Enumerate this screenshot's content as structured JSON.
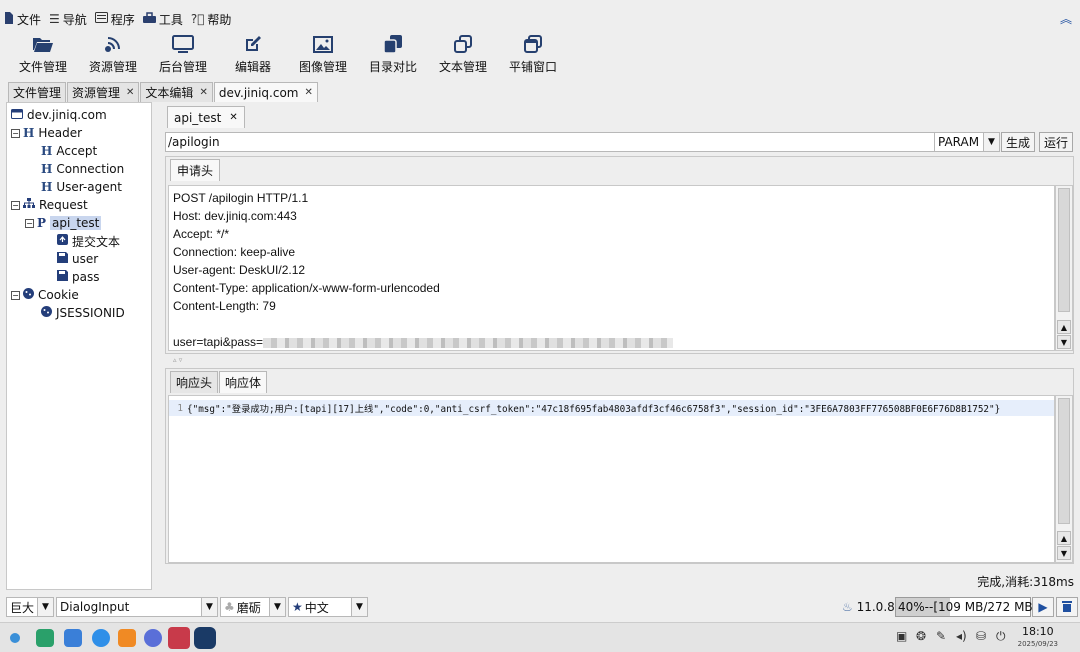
{
  "menubar": {
    "items": [
      {
        "icon": "file-icon",
        "label": "文件"
      },
      {
        "icon": "nav-icon",
        "label": "导航"
      },
      {
        "icon": "program-icon",
        "label": "程序"
      },
      {
        "icon": "tools-icon",
        "label": "工具"
      },
      {
        "icon": "help-icon",
        "label": "帮助"
      }
    ]
  },
  "toolbar": {
    "items": [
      {
        "icon": "folder-open-icon",
        "label": "文件管理"
      },
      {
        "icon": "resource-icon",
        "label": "资源管理"
      },
      {
        "icon": "monitor-icon",
        "label": "后台管理"
      },
      {
        "icon": "edit-icon",
        "label": "编辑器"
      },
      {
        "icon": "image-icon",
        "label": "图像管理"
      },
      {
        "icon": "diff-icon",
        "label": "目录对比"
      },
      {
        "icon": "text-icon",
        "label": "文本管理"
      },
      {
        "icon": "tile-window-icon",
        "label": "平铺窗口"
      }
    ]
  },
  "main_tabs": [
    {
      "label": "文件管理",
      "closable": false
    },
    {
      "label": "资源管理",
      "closable": true
    },
    {
      "label": "文本编辑",
      "closable": true
    },
    {
      "label": "dev.jiniq.com",
      "closable": true,
      "active": true
    }
  ],
  "tree": {
    "root": "dev.jiniq.com",
    "header": "Header",
    "accept": "Accept",
    "connection": "Connection",
    "user_agent": "User-agent",
    "request": "Request",
    "api_test": "api_test",
    "submit_text": "提交文本",
    "user": "user",
    "pass": "pass",
    "cookie": "Cookie",
    "jsessionid": "JSESSIONID"
  },
  "request_panel": {
    "tab": "api_test",
    "url": "/apilogin",
    "method_select": "PARAM",
    "generate_button": "生成",
    "run_button": "运行",
    "headers_tab": "申请头",
    "lines": [
      "POST /apilogin HTTP/1.1",
      "Host: dev.jiniq.com:443",
      "Accept: */*",
      "Connection: keep-alive",
      "User-agent: DeskUI/2.12",
      "Content-Type: application/x-www-form-urlencoded",
      "Content-Length: 79",
      "",
      "user=tapi&pass="
    ]
  },
  "response_panel": {
    "tabs": [
      "响应头",
      "响应体"
    ],
    "active_tab": 1,
    "line_number": "1",
    "body": "{\"msg\":\"登录成功;用户:[tapi][17]上线\",\"code\":0,\"anti_csrf_token\":\"47c18f695fab4803afdf3cf46c6758f3\",\"session_id\":\"3FE6A7803FF776508BF0E6F76D8B1752\"}"
  },
  "status": "完成,消耗:318ms",
  "bottom": {
    "size_select": "巨大",
    "font_select": "DialogInput",
    "theme_select": "磨砺",
    "lang_select": "中文",
    "java_version": "11.0.8",
    "memory": "40%--[109 MB/272 MB]",
    "memory_fraction": 0.4
  },
  "taskbar": {
    "time": "18:10",
    "date": "2025/09/23"
  },
  "colors": {
    "accent": "#2050a0",
    "selection": "#c9d6ee",
    "response_highlight": "#e6eefb"
  }
}
